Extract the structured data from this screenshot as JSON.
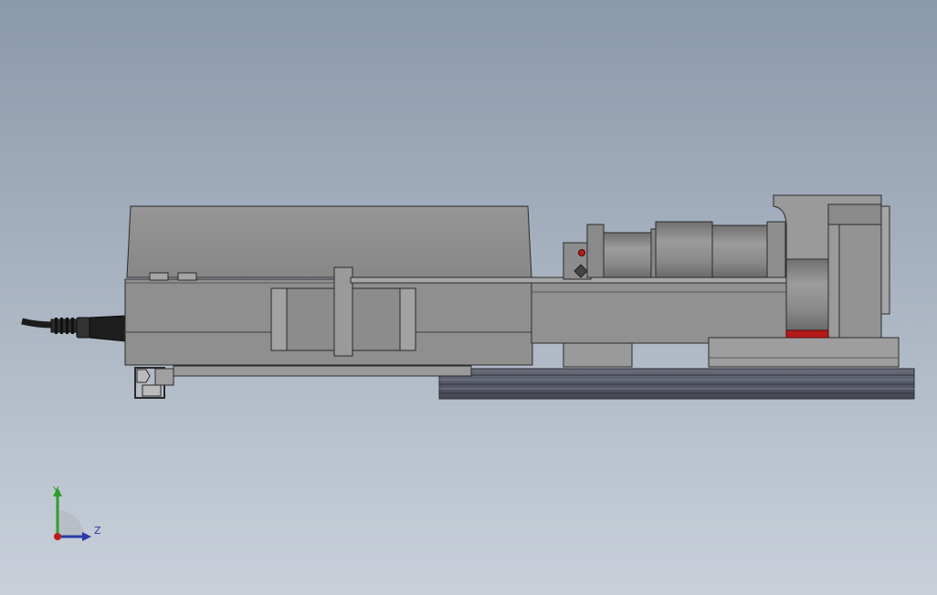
{
  "viewport": {
    "background_top": "#8a99ab",
    "background_bottom": "#c9d0da"
  },
  "model": {
    "name": "linear-actuator-assembly",
    "body_color": "#8e8e8e",
    "edge_color": "#2a2a2a",
    "rail_color": "#5a5e6c",
    "accent_color": "#b51a1a"
  },
  "triad": {
    "y_label": "Y",
    "z_label": "Z",
    "y_color": "#2f9e2f",
    "z_color": "#2b3aa8",
    "x_color": "#c01a1a"
  }
}
